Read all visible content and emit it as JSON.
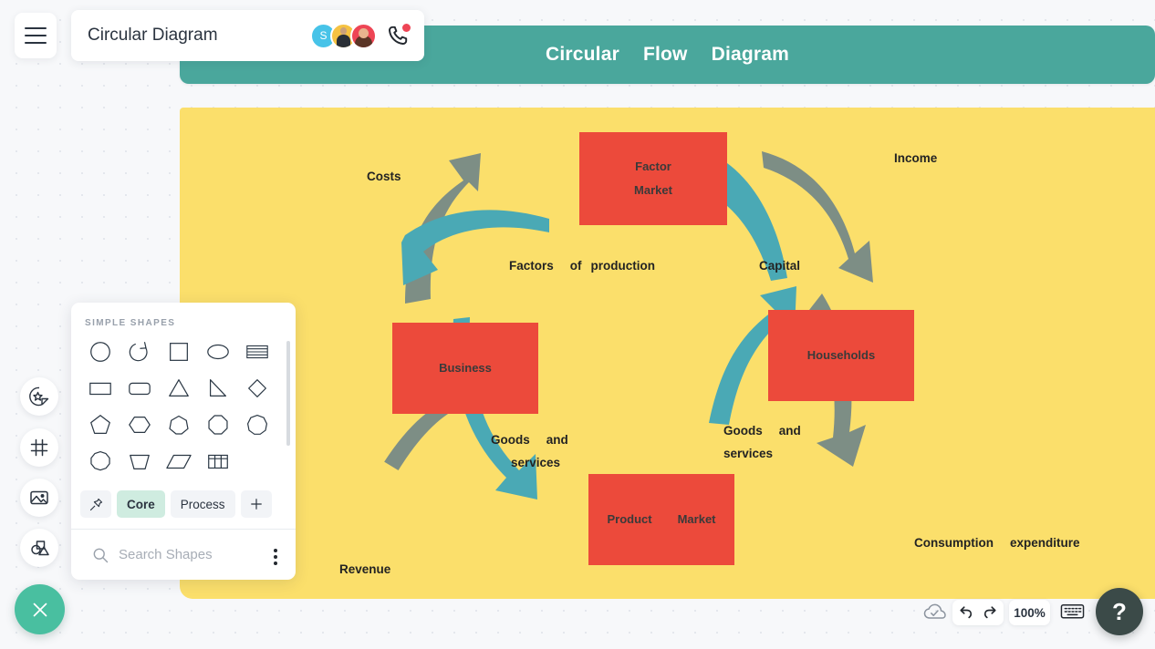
{
  "app": {
    "document_title": "Circular Diagram",
    "menu_icon": "hamburger-menu-icon",
    "phone_icon": "phone-call-icon",
    "avatars": [
      {
        "name": "avatar-initial",
        "initial": "S"
      },
      {
        "name": "avatar-photo-2",
        "initial": ""
      },
      {
        "name": "avatar-photo-3",
        "initial": ""
      }
    ]
  },
  "left_rail": {
    "items": [
      {
        "icon": "sticker-star-icon",
        "label": "Stickers"
      },
      {
        "icon": "frame-icon",
        "label": "Frames"
      },
      {
        "icon": "image-icon",
        "label": "Images"
      },
      {
        "icon": "shapes-icon",
        "label": "Shapes"
      }
    ],
    "close_icon": "close-x-icon"
  },
  "shapes_panel": {
    "section_title": "SIMPLE SHAPES",
    "shapes": [
      "circle-shape",
      "arc-arrow-shape",
      "square-shape",
      "ellipse-shape",
      "table-rows-shape",
      "rectangle-shape",
      "rounded-rectangle-shape",
      "triangle-shape",
      "right-triangle-shape",
      "diamond-shape",
      "pentagon-shape",
      "hexagon-shape",
      "heptagon-shape",
      "octagon-shape",
      "nonagon-shape",
      "decagon-shape",
      "trapezoid-shape",
      "parallelogram-shape",
      "grid-table-shape"
    ],
    "tabs": [
      {
        "label": "",
        "icon": "pin-icon",
        "active": false
      },
      {
        "label": "Core",
        "icon": "",
        "active": true
      },
      {
        "label": "Process",
        "icon": "",
        "active": false
      },
      {
        "label": "",
        "icon": "plus-icon",
        "active": false
      }
    ],
    "search": {
      "placeholder": "Search Shapes",
      "icon": "search-icon",
      "more_icon": "kebab-menu-icon"
    }
  },
  "diagram": {
    "header_words": [
      "Circular",
      "Flow",
      "Diagram"
    ],
    "header_bg": "#4aa79c",
    "canvas_bg": "#fbdf6b",
    "node_color": "#ec4a3b",
    "arrow_gray": "#7d8e85",
    "arrow_teal": "#4aa9b5",
    "nodes": [
      {
        "name": "factor-market-node",
        "lines": [
          "Factor",
          "Market"
        ]
      },
      {
        "name": "households-node",
        "lines": [
          "Households"
        ]
      },
      {
        "name": "business-node",
        "lines": [
          "Business"
        ]
      },
      {
        "name": "product-market-node",
        "lines": [
          "Product",
          "Market"
        ]
      }
    ],
    "labels": [
      {
        "name": "label-costs",
        "text": "Costs"
      },
      {
        "name": "label-income",
        "text": "Income"
      },
      {
        "name": "label-factors-of-production",
        "text": "Factors",
        "text2": "of",
        "text3": "production"
      },
      {
        "name": "label-capital",
        "text": "Capital"
      },
      {
        "name": "label-goods-and-services-left",
        "line1a": "Goods",
        "line1b": "and",
        "line2": "services"
      },
      {
        "name": "label-goods-and-services-right",
        "line1a": "Goods",
        "line1b": "and",
        "line2": "services"
      },
      {
        "name": "label-revenue",
        "text": "Revenue"
      },
      {
        "name": "label-consumption-expenditure",
        "text": "Consumption",
        "text2": "expenditure"
      }
    ]
  },
  "bottom_bar": {
    "cloud_icon": "cloud-saved-icon",
    "undo_icon": "undo-icon",
    "redo_icon": "redo-icon",
    "zoom_level": "100%",
    "keyboard_icon": "keyboard-shortcuts-icon",
    "help_label": "?"
  }
}
